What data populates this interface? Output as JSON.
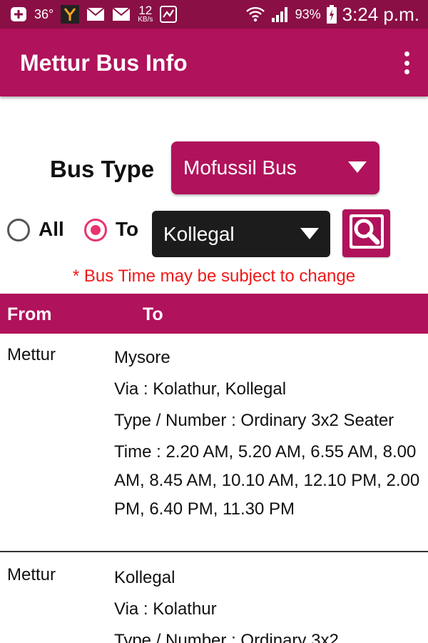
{
  "status_bar": {
    "left_icons": [
      "add-box-icon",
      "temperature-text",
      "y-app-icon",
      "mail-icon",
      "mail-icon",
      "data-speed",
      "chart-app-icon"
    ],
    "temperature": "36°",
    "data_speed_value": "12",
    "data_speed_unit": "KB/s",
    "right_icons": [
      "wifi-icon",
      "signal-icon",
      "battery-icon"
    ],
    "battery": "93%",
    "time": "3:24 p.m."
  },
  "app_bar": {
    "title": "Mettur Bus Info",
    "menu_icon": "overflow-menu-icon"
  },
  "filters": {
    "bus_type_label": "Bus Type",
    "bus_type_value": "Mofussil Bus",
    "radio_all_label": "All",
    "radio_to_label": "To",
    "selected_radio": "To",
    "destination_value": "Kollegal",
    "search_icon": "search-icon"
  },
  "note": "* Bus Time may be subject to change",
  "table": {
    "headers": {
      "from": "From",
      "to": "To"
    },
    "rows": [
      {
        "from": "Mettur",
        "to": "Mysore",
        "via": "Via : Kolathur, Kollegal",
        "type": "Type / Number :  Ordinary 3x2 Seater",
        "time": "Time : 2.20 AM,  5.20 AM,  6.55 AM,  8.00 AM,  8.45 AM,  10.10 AM,  12.10 PM,  2.00 PM,  6.40 PM,  11.30 PM"
      },
      {
        "from": "Mettur",
        "to": "Kollegal",
        "via": "Via : Kolathur",
        "type": "Type / Number :  Ordinary 3x2"
      }
    ]
  },
  "colors": {
    "status_bar": "#8a0f45",
    "primary": "#b0125b",
    "radio_accent": "#e8336e",
    "note_red": "#f01818",
    "dark_select": "#1c1c1c"
  }
}
